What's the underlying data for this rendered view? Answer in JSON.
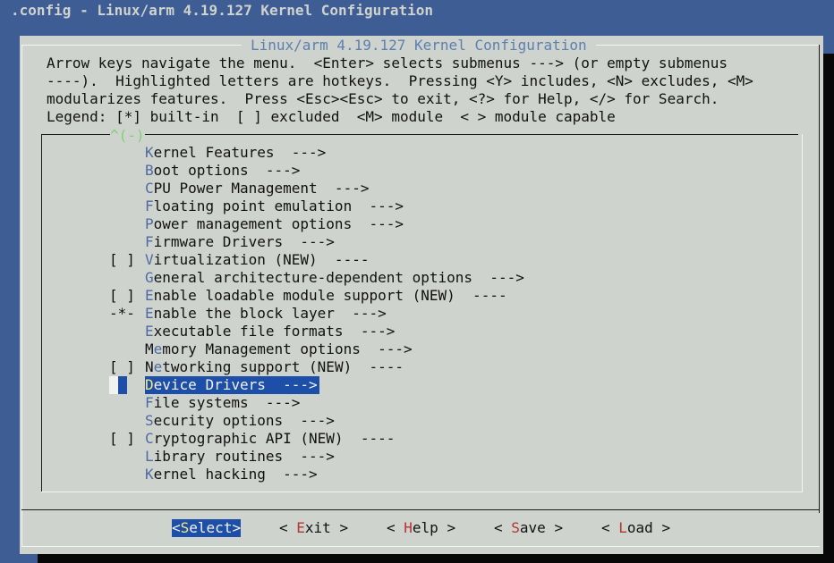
{
  "window": {
    "backtitle": ".config - Linux/arm 4.19.127 Kernel Configuration"
  },
  "dialog": {
    "title": "Linux/arm 4.19.127 Kernel Configuration",
    "help_lines": [
      "Arrow keys navigate the menu.  <Enter> selects submenus ---> (or empty submenus",
      "----).  Highlighted letters are hotkeys.  Pressing <Y> includes, <N> excludes, <M>",
      "modularizes features.  Press <Esc><Esc> to exit, <?> for Help, </> for Search.",
      "Legend: [*] built-in  [ ] excluded  <M> module  < > module capable"
    ],
    "scroll_indicator": "^(-)"
  },
  "menu": {
    "items": [
      {
        "prefix": "",
        "hotkey": "K",
        "rest": "ernel Features  --->",
        "selected": false
      },
      {
        "prefix": "",
        "hotkey": "B",
        "rest": "oot options  --->",
        "selected": false
      },
      {
        "prefix": "",
        "hotkey": "C",
        "rest": "PU Power Management  --->",
        "selected": false
      },
      {
        "prefix": "",
        "hotkey": "F",
        "rest": "loating point emulation  --->",
        "selected": false
      },
      {
        "prefix": "",
        "hotkey": "P",
        "rest": "ower management options  --->",
        "selected": false
      },
      {
        "prefix": "",
        "hotkey": "F",
        "rest": "irmware Drivers  --->",
        "selected": false
      },
      {
        "prefix": "[ ]",
        "hotkey": "V",
        "rest": "irtualization (NEW)  ----",
        "selected": false
      },
      {
        "prefix": "",
        "hotkey": "G",
        "rest": "eneral architecture-dependent options  --->",
        "selected": false
      },
      {
        "prefix": "[ ]",
        "hotkey": "E",
        "rest": "nable loadable module support (NEW)  ----",
        "selected": false
      },
      {
        "prefix": "-*-",
        "hotkey": "E",
        "rest": "nable the block layer  --->",
        "selected": false
      },
      {
        "prefix": "",
        "hotkey": "E",
        "rest": "xecutable file formats  --->",
        "selected": false
      },
      {
        "prefix": "",
        "pre": "M",
        "hotkey": "e",
        "rest": "mory Management options  --->",
        "selected": false
      },
      {
        "prefix": "[ ]",
        "pre": "N",
        "hotkey": "e",
        "rest": "tworking support (NEW)  ----",
        "selected": false
      },
      {
        "prefix": "",
        "hotkey": "D",
        "rest": "evice Drivers  --->",
        "selected": true
      },
      {
        "prefix": "",
        "hotkey": "F",
        "rest": "ile systems  --->",
        "selected": false
      },
      {
        "prefix": "",
        "hotkey": "S",
        "rest": "ecurity options  --->",
        "selected": false
      },
      {
        "prefix": "[ ]",
        "hotkey": "C",
        "rest": "ryptographic API (NEW)  ----",
        "selected": false
      },
      {
        "prefix": "",
        "hotkey": "L",
        "rest": "ibrary routines  --->",
        "selected": false
      },
      {
        "prefix": "",
        "hotkey": "K",
        "rest": "ernel hacking  --->",
        "selected": false
      }
    ]
  },
  "buttons": [
    {
      "name": "select-button",
      "open": "<",
      "hotkey": "S",
      "rest": "elect",
      "close": ">",
      "active": true
    },
    {
      "name": "exit-button",
      "open": "< ",
      "hotkey": "E",
      "rest": "xit",
      "close": " >",
      "active": false
    },
    {
      "name": "help-button",
      "open": "< ",
      "hotkey": "H",
      "rest": "elp",
      "close": " >",
      "active": false
    },
    {
      "name": "save-button",
      "open": "< ",
      "hotkey": "S",
      "rest": "ave",
      "close": " >",
      "active": false
    },
    {
      "name": "load-button",
      "open": "< ",
      "hotkey": "L",
      "rest": "oad",
      "close": " >",
      "active": false
    }
  ],
  "colors": {
    "desktop": "#3d5d94",
    "dialog": "#cfd3cd",
    "selection": "#1d4fa8",
    "hotkey": "#4f6aa2",
    "button_hotkey": "#b23535",
    "selected_hotkey": "#f6e87a",
    "scroll_indicator": "#7fd16e"
  }
}
